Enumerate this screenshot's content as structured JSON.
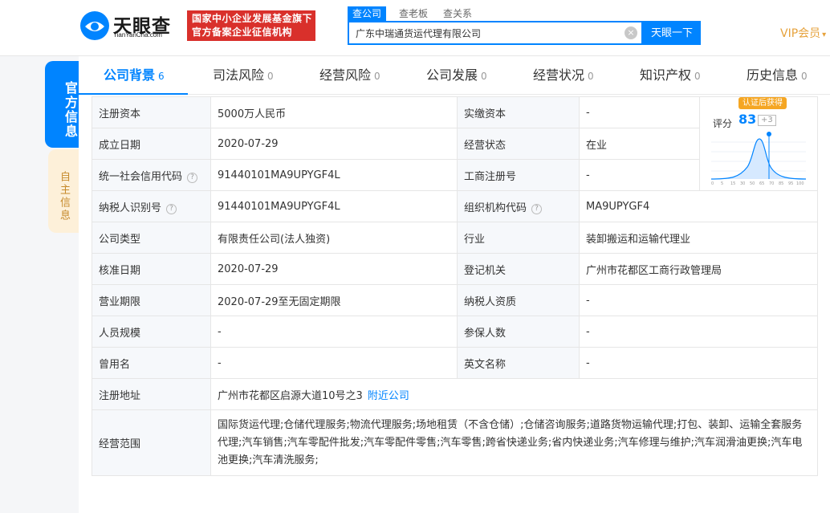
{
  "header": {
    "logo_text": "天眼查",
    "logo_sub": "TianYanCha.com",
    "badge_line1": "国家中小企业发展基金旗下",
    "badge_line2": "官方备案企业征信机构",
    "search_tabs": [
      "查公司",
      "查老板",
      "查关系"
    ],
    "search_value": "广东中瑞通货运代理有限公司",
    "search_button": "天眼一下",
    "vip": "VIP会员"
  },
  "side": {
    "main_tab": "官方信息",
    "second_tab": "自主信息"
  },
  "tabs": [
    {
      "label": "公司背景",
      "count": "6"
    },
    {
      "label": "司法风险",
      "count": "0"
    },
    {
      "label": "经营风险",
      "count": "0"
    },
    {
      "label": "公司发展",
      "count": "0"
    },
    {
      "label": "经营状况",
      "count": "0"
    },
    {
      "label": "知识产权",
      "count": "0"
    },
    {
      "label": "历史信息",
      "count": "0"
    }
  ],
  "score": {
    "tag": "认证后获得",
    "label": "评分",
    "value": "83",
    "delta": "+3",
    "axis_ticks": [
      "0",
      "5",
      "15",
      "30",
      "50",
      "65",
      "70",
      "85",
      "95",
      "100"
    ]
  },
  "info": {
    "reg_capital_label": "注册资本",
    "reg_capital": "5000万人民币",
    "paid_capital_label": "实缴资本",
    "paid_capital": "-",
    "founded_label": "成立日期",
    "founded": "2020-07-29",
    "status_label": "经营状态",
    "status": "在业",
    "credit_code_label": "统一社会信用代码",
    "credit_code": "91440101MA9UPYGF4L",
    "biz_reg_label": "工商注册号",
    "biz_reg": "-",
    "taxpayer_id_label": "纳税人识别号",
    "taxpayer_id": "91440101MA9UPYGF4L",
    "org_code_label": "组织机构代码",
    "org_code": "MA9UPYGF4",
    "type_label": "公司类型",
    "type": "有限责任公司(法人独资)",
    "industry_label": "行业",
    "industry": "装卸搬运和运输代理业",
    "approve_label": "核准日期",
    "approve": "2020-07-29",
    "authority_label": "登记机关",
    "authority": "广州市花都区工商行政管理局",
    "term_label": "营业期限",
    "term": "2020-07-29至无固定期限",
    "taxpayer_qual_label": "纳税人资质",
    "taxpayer_qual": "-",
    "staff_label": "人员规模",
    "staff": "-",
    "insured_label": "参保人数",
    "insured": "-",
    "former_name_label": "曾用名",
    "former_name": "-",
    "english_label": "英文名称",
    "english": "-",
    "address_label": "注册地址",
    "address": "广州市花都区启源大道10号之3",
    "nearby": "附近公司",
    "scope_label": "经营范围",
    "scope": "国际货运代理;仓储代理服务;物流代理服务;场地租赁（不含仓储）;仓储咨询服务;道路货物运输代理;打包、装卸、运输全套服务代理;汽车销售;汽车零配件批发;汽车零配件零售;汽车零售;跨省快递业务;省内快递业务;汽车修理与维护;汽车润滑油更换;汽车电池更换;汽车清洗服务;"
  },
  "colors": {
    "brand": "#0084ff",
    "badge": "#d9302b",
    "vip": "#e6a23c",
    "score_tag": "#f5a623"
  }
}
